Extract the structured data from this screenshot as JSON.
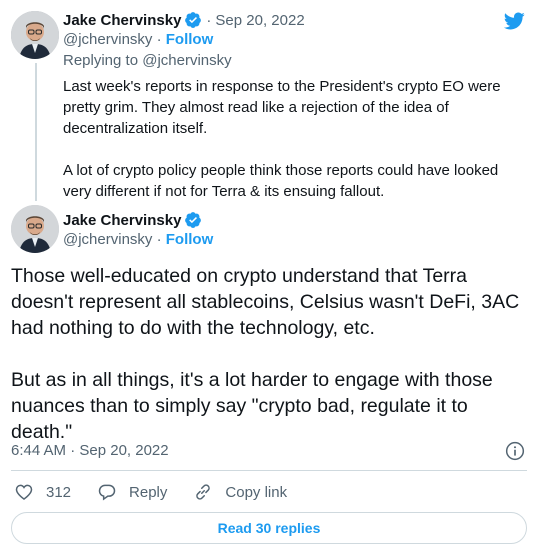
{
  "parent": {
    "display_name": "Jake Chervinsky",
    "date": "Sep 20, 2022",
    "handle": "@jchervinsky",
    "follow_label": "Follow",
    "replying_to": "Replying to @jchervinsky",
    "paragraphs": [
      "Last week's reports in response to the President's crypto EO were pretty grim. They almost read like a rejection of the idea of decentralization itself.",
      "A lot of crypto policy people think those reports could have looked very different if not for Terra & its ensuing fallout."
    ]
  },
  "main": {
    "display_name": "Jake Chervinsky",
    "handle": "@jchervinsky",
    "follow_label": "Follow",
    "paragraphs": [
      "Those well-educated on crypto understand that Terra doesn't represent all stablecoins, Celsius wasn't DeFi, 3AC had nothing to do with the technology, etc.",
      "But as in all things, it's a lot harder to engage with those nuances than to simply say \"crypto bad, regulate it to death.\""
    ],
    "timestamp": "6:44 AM · Sep 20, 2022"
  },
  "actions": {
    "like_count": "312",
    "reply_label": "Reply",
    "copy_link_label": "Copy link"
  },
  "read_replies_label": "Read 30 replies",
  "colors": {
    "accent": "#1d9bf0",
    "text": "#0f1419",
    "muted": "#536471",
    "border": "#cfd9de"
  },
  "icons": [
    "verified-badge-icon",
    "twitter-bird-icon",
    "info-icon",
    "heart-icon",
    "reply-icon",
    "link-icon"
  ]
}
